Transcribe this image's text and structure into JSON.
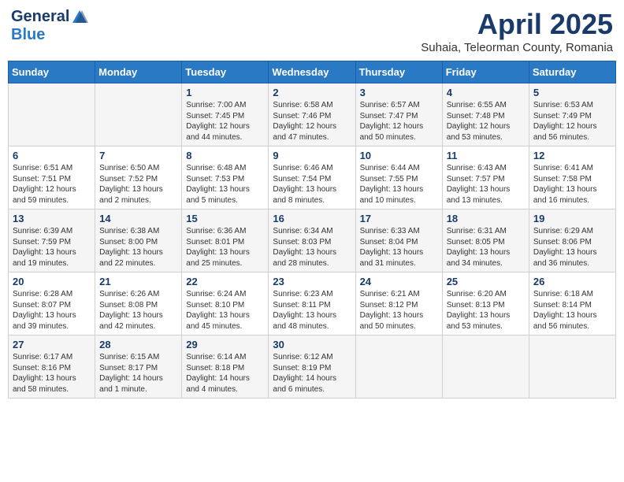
{
  "header": {
    "logo_general": "General",
    "logo_blue": "Blue",
    "month_title": "April 2025",
    "location": "Suhaia, Teleorman County, Romania"
  },
  "weekdays": [
    "Sunday",
    "Monday",
    "Tuesday",
    "Wednesday",
    "Thursday",
    "Friday",
    "Saturday"
  ],
  "weeks": [
    [
      {
        "day": "",
        "content": ""
      },
      {
        "day": "",
        "content": ""
      },
      {
        "day": "1",
        "content": "Sunrise: 7:00 AM\nSunset: 7:45 PM\nDaylight: 12 hours\nand 44 minutes."
      },
      {
        "day": "2",
        "content": "Sunrise: 6:58 AM\nSunset: 7:46 PM\nDaylight: 12 hours\nand 47 minutes."
      },
      {
        "day": "3",
        "content": "Sunrise: 6:57 AM\nSunset: 7:47 PM\nDaylight: 12 hours\nand 50 minutes."
      },
      {
        "day": "4",
        "content": "Sunrise: 6:55 AM\nSunset: 7:48 PM\nDaylight: 12 hours\nand 53 minutes."
      },
      {
        "day": "5",
        "content": "Sunrise: 6:53 AM\nSunset: 7:49 PM\nDaylight: 12 hours\nand 56 minutes."
      }
    ],
    [
      {
        "day": "6",
        "content": "Sunrise: 6:51 AM\nSunset: 7:51 PM\nDaylight: 12 hours\nand 59 minutes."
      },
      {
        "day": "7",
        "content": "Sunrise: 6:50 AM\nSunset: 7:52 PM\nDaylight: 13 hours\nand 2 minutes."
      },
      {
        "day": "8",
        "content": "Sunrise: 6:48 AM\nSunset: 7:53 PM\nDaylight: 13 hours\nand 5 minutes."
      },
      {
        "day": "9",
        "content": "Sunrise: 6:46 AM\nSunset: 7:54 PM\nDaylight: 13 hours\nand 8 minutes."
      },
      {
        "day": "10",
        "content": "Sunrise: 6:44 AM\nSunset: 7:55 PM\nDaylight: 13 hours\nand 10 minutes."
      },
      {
        "day": "11",
        "content": "Sunrise: 6:43 AM\nSunset: 7:57 PM\nDaylight: 13 hours\nand 13 minutes."
      },
      {
        "day": "12",
        "content": "Sunrise: 6:41 AM\nSunset: 7:58 PM\nDaylight: 13 hours\nand 16 minutes."
      }
    ],
    [
      {
        "day": "13",
        "content": "Sunrise: 6:39 AM\nSunset: 7:59 PM\nDaylight: 13 hours\nand 19 minutes."
      },
      {
        "day": "14",
        "content": "Sunrise: 6:38 AM\nSunset: 8:00 PM\nDaylight: 13 hours\nand 22 minutes."
      },
      {
        "day": "15",
        "content": "Sunrise: 6:36 AM\nSunset: 8:01 PM\nDaylight: 13 hours\nand 25 minutes."
      },
      {
        "day": "16",
        "content": "Sunrise: 6:34 AM\nSunset: 8:03 PM\nDaylight: 13 hours\nand 28 minutes."
      },
      {
        "day": "17",
        "content": "Sunrise: 6:33 AM\nSunset: 8:04 PM\nDaylight: 13 hours\nand 31 minutes."
      },
      {
        "day": "18",
        "content": "Sunrise: 6:31 AM\nSunset: 8:05 PM\nDaylight: 13 hours\nand 34 minutes."
      },
      {
        "day": "19",
        "content": "Sunrise: 6:29 AM\nSunset: 8:06 PM\nDaylight: 13 hours\nand 36 minutes."
      }
    ],
    [
      {
        "day": "20",
        "content": "Sunrise: 6:28 AM\nSunset: 8:07 PM\nDaylight: 13 hours\nand 39 minutes."
      },
      {
        "day": "21",
        "content": "Sunrise: 6:26 AM\nSunset: 8:08 PM\nDaylight: 13 hours\nand 42 minutes."
      },
      {
        "day": "22",
        "content": "Sunrise: 6:24 AM\nSunset: 8:10 PM\nDaylight: 13 hours\nand 45 minutes."
      },
      {
        "day": "23",
        "content": "Sunrise: 6:23 AM\nSunset: 8:11 PM\nDaylight: 13 hours\nand 48 minutes."
      },
      {
        "day": "24",
        "content": "Sunrise: 6:21 AM\nSunset: 8:12 PM\nDaylight: 13 hours\nand 50 minutes."
      },
      {
        "day": "25",
        "content": "Sunrise: 6:20 AM\nSunset: 8:13 PM\nDaylight: 13 hours\nand 53 minutes."
      },
      {
        "day": "26",
        "content": "Sunrise: 6:18 AM\nSunset: 8:14 PM\nDaylight: 13 hours\nand 56 minutes."
      }
    ],
    [
      {
        "day": "27",
        "content": "Sunrise: 6:17 AM\nSunset: 8:16 PM\nDaylight: 13 hours\nand 58 minutes."
      },
      {
        "day": "28",
        "content": "Sunrise: 6:15 AM\nSunset: 8:17 PM\nDaylight: 14 hours\nand 1 minute."
      },
      {
        "day": "29",
        "content": "Sunrise: 6:14 AM\nSunset: 8:18 PM\nDaylight: 14 hours\nand 4 minutes."
      },
      {
        "day": "30",
        "content": "Sunrise: 6:12 AM\nSunset: 8:19 PM\nDaylight: 14 hours\nand 6 minutes."
      },
      {
        "day": "",
        "content": ""
      },
      {
        "day": "",
        "content": ""
      },
      {
        "day": "",
        "content": ""
      }
    ]
  ]
}
